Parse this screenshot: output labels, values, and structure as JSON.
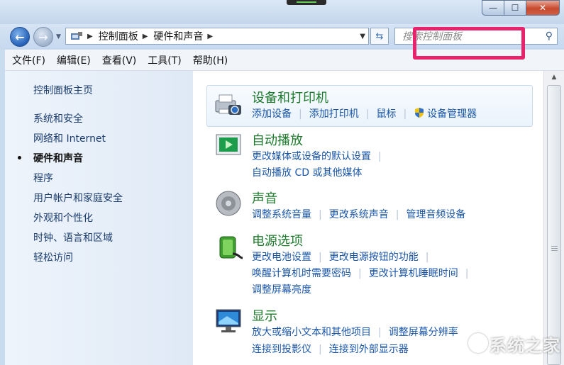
{
  "window": {
    "minimize_glyph": "—",
    "maximize_glyph": "☐",
    "close_glyph": "✕"
  },
  "nav": {
    "back_glyph": "←",
    "forward_glyph": "→",
    "breadcrumbs": [
      "控制面板",
      "硬件和声音"
    ],
    "search_placeholder": "搜索控制面板"
  },
  "menu": [
    "文件(F)",
    "编辑(E)",
    "查看(V)",
    "工具(T)",
    "帮助(H)"
  ],
  "sidebar": {
    "home": "控制面板主页",
    "items": [
      "系统和安全",
      "网络和 Internet",
      "硬件和声音",
      "程序",
      "用户帐户和家庭安全",
      "外观和个性化",
      "时钟、语言和区域",
      "轻松访问"
    ],
    "active_index": 2
  },
  "categories": [
    {
      "title": "设备和打印机",
      "icon": "printer-camera-icon",
      "lines": [
        [
          "添加设备",
          "添加打印机",
          "鼠标",
          "设备管理器"
        ]
      ]
    },
    {
      "title": "自动播放",
      "icon": "autoplay-icon",
      "lines": [
        [
          "更改媒体或设备的默认设置"
        ],
        [
          "自动播放 CD 或其他媒体"
        ]
      ]
    },
    {
      "title": "声音",
      "icon": "speaker-icon",
      "lines": [
        [
          "调整系统音量",
          "更改系统声音",
          "管理音频设备"
        ]
      ]
    },
    {
      "title": "电源选项",
      "icon": "battery-icon",
      "lines": [
        [
          "更改电池设置",
          "更改电源按钮的功能"
        ],
        [
          "唤醒计算机时需要密码",
          "更改计算机睡眠时间"
        ],
        [
          "调整屏幕亮度"
        ]
      ]
    },
    {
      "title": "显示",
      "icon": "display-icon",
      "lines": [
        [
          "放大或缩小文本和其他项目",
          "调整屏幕分辨率"
        ],
        [
          "连接到投影仪",
          "连接到外部显示器"
        ]
      ]
    }
  ],
  "highlight_color": "#e8236b",
  "watermark": "系统之家"
}
